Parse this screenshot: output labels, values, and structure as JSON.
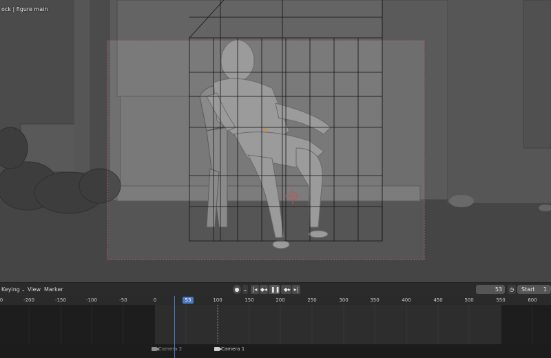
{
  "viewport": {
    "breadcrumb": "ock | figure main"
  },
  "timeline": {
    "keying_label": "Keying",
    "view_label": "View",
    "marker_label": "Marker",
    "playback_icons": [
      "jump-start-icon",
      "prev-keyframe-icon",
      "play-reverse-icon",
      "pause-icon",
      "play-icon",
      "next-keyframe-icon",
      "jump-end-icon"
    ],
    "current_frame": "53",
    "start_label": "Start",
    "start_value": "1",
    "ruler_ticks": [
      "0",
      "-200",
      "-150",
      "-100",
      "-50",
      "0",
      "100",
      "150",
      "200",
      "250",
      "300",
      "350",
      "400",
      "450",
      "500",
      "550",
      "600"
    ],
    "markers": [
      {
        "label": "Camera 2",
        "active": false
      },
      {
        "label": "Camera 1",
        "active": true
      }
    ]
  },
  "colors": {
    "accent": "#4a78c2",
    "viewport_bg": "#5f5f5f",
    "camera_frame": "#b25a5a"
  }
}
